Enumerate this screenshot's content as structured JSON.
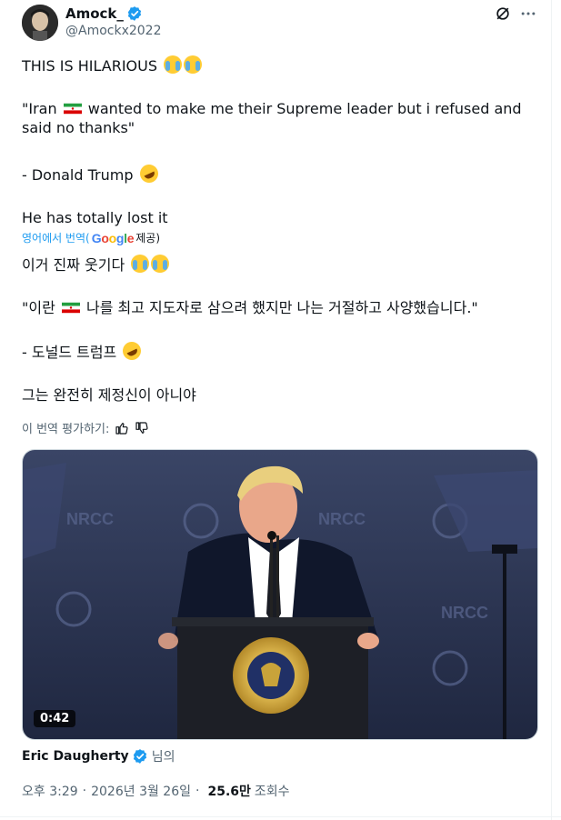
{
  "author": {
    "display_name": "Amock_",
    "handle": "@Amockx2022",
    "verified": true
  },
  "tweet": {
    "line1": "THIS IS HILARIOUS",
    "quote_part1": "\"Iran",
    "quote_part2": " wanted to make me their Supreme leader but i refused and said no thanks\"",
    "attribution": "- Donald Trump",
    "closing": "He has totally lost it"
  },
  "translation_bar": {
    "label": "영어에서 번역(",
    "google": "Google",
    "provided": "제공)"
  },
  "translated": {
    "line1": "이거 진짜 웃기다",
    "quote_part1": "\"이란",
    "quote_part2": " 나를 최고 지도자로 삼으려 했지만 나는 거절하고 사양했습니다.\"",
    "attribution": "- 도널드 트럼프",
    "closing": "그는 완전히 제정신이 아니야"
  },
  "rate": {
    "label": "이 번역 평가하기:"
  },
  "media": {
    "duration": "0:42",
    "backdrop_logo_text": "NRCC",
    "colors": {
      "backdrop": "#2c3553",
      "podium": "#1c1e24",
      "seal": "#c9a33a"
    }
  },
  "attribution_line": {
    "name": "Eric Daugherty",
    "suffix": "님의"
  },
  "meta": {
    "time": "오후 3:29",
    "date": "2026년 3월 26일",
    "views_count": "25.6만",
    "views_label": "조회수"
  },
  "icons": {
    "verified": "verified-badge-icon",
    "grok": "grok-icon",
    "more": "more-icon",
    "thumbs_up": "thumbs-up-icon",
    "thumbs_down": "thumbs-down-icon"
  },
  "colors": {
    "accent": "#1d9bf0",
    "text": "#0f1419",
    "muted": "#536471"
  }
}
